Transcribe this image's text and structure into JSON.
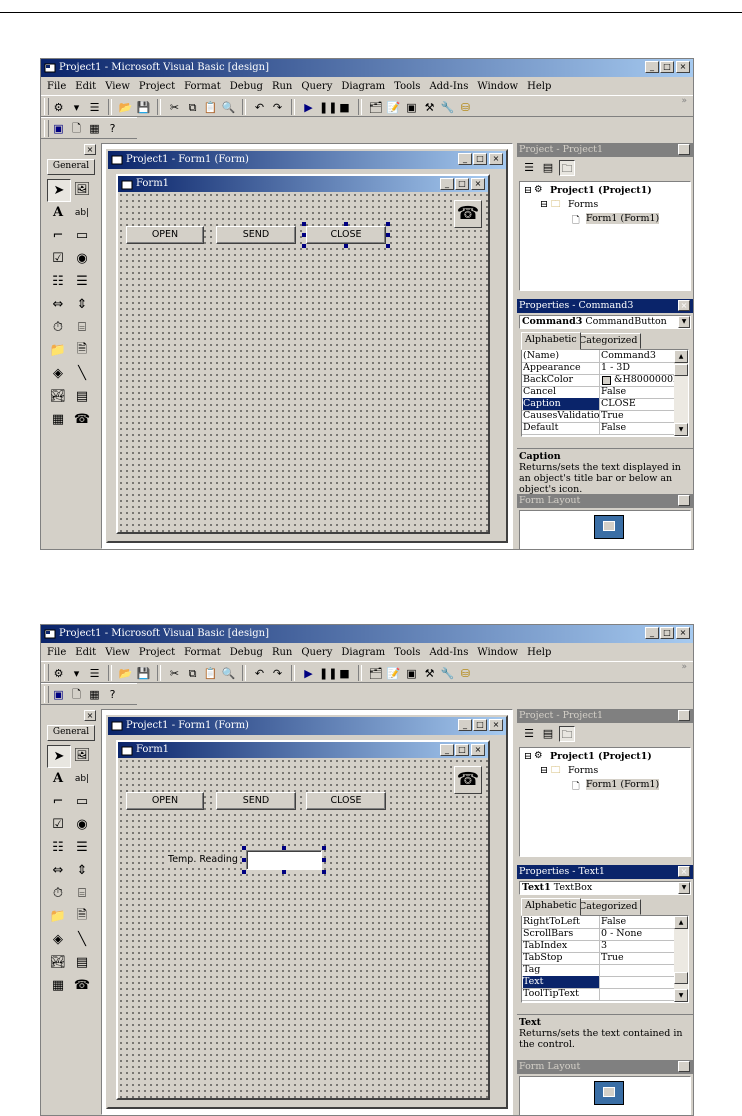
{
  "screens": [
    {
      "app_title": "Project1 - Microsoft Visual Basic [design]",
      "menu": [
        "File",
        "Edit",
        "View",
        "Project",
        "Format",
        "Debug",
        "Run",
        "Query",
        "Diagram",
        "Tools",
        "Add-Ins",
        "Window",
        "Help"
      ],
      "toolbox": {
        "tab": "General"
      },
      "project_window_title": "Project1 - Form1 (Form)",
      "form_title": "Form1",
      "buttons": {
        "open": "OPEN",
        "send": "SEND",
        "close": "CLOSE"
      },
      "explorer": {
        "title": "Project - Project1",
        "root": "Project1 (Project1)",
        "folder": "Forms",
        "item": "Form1 (Form1)"
      },
      "properties": {
        "title": "Properties - Command3",
        "object_name": "Command3",
        "object_type": "CommandButton",
        "tabs": [
          "Alphabetic",
          "Categorized"
        ],
        "rows": [
          {
            "name": "(Name)",
            "value": "Command3"
          },
          {
            "name": "Appearance",
            "value": "1 - 3D"
          },
          {
            "name": "BackColor",
            "value": "&H8000000F"
          },
          {
            "name": "Cancel",
            "value": "False"
          },
          {
            "name": "Caption",
            "value": "CLOSE"
          },
          {
            "name": "CausesValidation",
            "value": "True"
          },
          {
            "name": "Default",
            "value": "False"
          }
        ],
        "selected_index": 4
      },
      "description": {
        "title": "Caption",
        "text": "Returns/sets the text displayed in an object's title bar or below an object's icon."
      },
      "layout_title": "Form Layout"
    },
    {
      "app_title": "Project1 - Microsoft Visual Basic [design]",
      "menu": [
        "File",
        "Edit",
        "View",
        "Project",
        "Format",
        "Debug",
        "Run",
        "Query",
        "Diagram",
        "Tools",
        "Add-Ins",
        "Window",
        "Help"
      ],
      "toolbox": {
        "tab": "General"
      },
      "project_window_title": "Project1 - Form1 (Form)",
      "form_title": "Form1",
      "buttons": {
        "open": "OPEN",
        "send": "SEND",
        "close": "CLOSE"
      },
      "label_text": "Temp. Reading",
      "explorer": {
        "title": "Project - Project1",
        "root": "Project1 (Project1)",
        "folder": "Forms",
        "item": "Form1 (Form1)"
      },
      "properties": {
        "title": "Properties - Text1",
        "object_name": "Text1",
        "object_type": "TextBox",
        "tabs": [
          "Alphabetic",
          "Categorized"
        ],
        "rows": [
          {
            "name": "RightToLeft",
            "value": "False"
          },
          {
            "name": "ScrollBars",
            "value": "0 - None"
          },
          {
            "name": "TabIndex",
            "value": "3"
          },
          {
            "name": "TabStop",
            "value": "True"
          },
          {
            "name": "Tag",
            "value": ""
          },
          {
            "name": "Text",
            "value": ""
          },
          {
            "name": "ToolTipText",
            "value": ""
          }
        ],
        "selected_index": 5
      },
      "description": {
        "title": "Text",
        "text": "Returns/sets the text contained in the control."
      },
      "layout_title": "Form Layout"
    }
  ]
}
